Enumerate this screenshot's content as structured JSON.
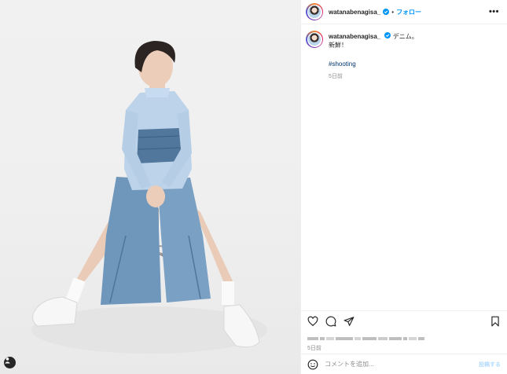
{
  "post": {
    "username": "watanabenagisa_",
    "dot": "•",
    "follow_label": "フォロー",
    "more_label": "•••",
    "caption": {
      "line1": "デニム。",
      "line2": "新鮮！",
      "hashtag": "#shooting",
      "time": "5日前"
    },
    "likes_text_redacted": true,
    "post_time": "5日前",
    "comment_placeholder": "コメントを追加...",
    "post_button": "投稿する"
  },
  "icons": {
    "verified": "verified-badge-icon",
    "like": "heart-icon",
    "comment": "comment-icon",
    "share": "paper-plane-icon",
    "save": "bookmark-icon",
    "emoji": "smiley-icon",
    "tagged_user": "person-icon"
  },
  "colors": {
    "link_blue": "#0095f6",
    "hashtag": "#00376b",
    "muted": "#8e8e8e",
    "verified": "#0095f6"
  }
}
